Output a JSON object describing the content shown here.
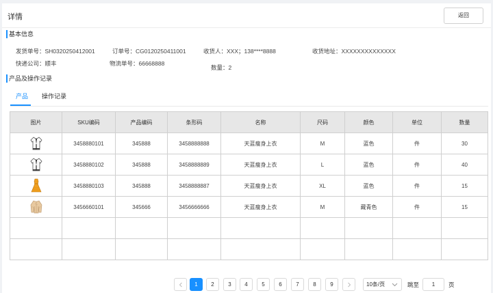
{
  "header": {
    "title": "详情",
    "back_label": "返回"
  },
  "basic": {
    "section_title": "基本信息",
    "ship_no": "发货单号：SH0320250412001",
    "order_no": "订单号：CG0120250411001",
    "receiver": "收货人：XXX；138****8888",
    "address": "收货地址：XXXXXXXXXXXXXX",
    "courier": "快递公司：顺丰",
    "tracking": "物流单号：66668888",
    "qty": "数量：2"
  },
  "products": {
    "section_title": "产品及操作记录",
    "tabs": [
      {
        "label": "产品"
      },
      {
        "label": "操作记录"
      }
    ],
    "columns": [
      "图片",
      "SKU编码",
      "产品编码",
      "条形码",
      "名称",
      "尺码",
      "颜色",
      "单位",
      "数量"
    ],
    "rows": [
      {
        "image": "white-top-thumbnail",
        "sku": "3458880101",
        "code": "345888",
        "barcode": "3458888888",
        "name": "天蓝瘦身上衣",
        "size": "M",
        "color": "蓝色",
        "unit": "件",
        "qty": "30"
      },
      {
        "image": "white-top-thumbnail",
        "sku": "3458880102",
        "code": "345888",
        "barcode": "3458888889",
        "name": "天蓝瘦身上衣",
        "size": "L",
        "color": "蓝色",
        "unit": "件",
        "qty": "40"
      },
      {
        "image": "yellow-dress-thumbnail",
        "sku": "3458880103",
        "code": "345888",
        "barcode": "3458888887",
        "name": "天蓝瘦身上衣",
        "size": "XL",
        "color": "蓝色",
        "unit": "件",
        "qty": "15"
      },
      {
        "image": "beige-jacket-thumbnail",
        "sku": "3456660101",
        "code": "345666",
        "barcode": "3456666666",
        "name": "天蓝瘦身上衣",
        "size": "M",
        "color": "藏青色",
        "unit": "件",
        "qty": "15"
      }
    ]
  },
  "pagination": {
    "prev_icon": "chevron-left-icon",
    "next_icon": "chevron-right-icon",
    "pages": [
      "1",
      "2",
      "3",
      "4",
      "5",
      "6",
      "7",
      "8",
      "9"
    ],
    "current": "1",
    "page_size": "10条/页",
    "jump_label": "跳至",
    "jump_value": "1",
    "page_suffix": "页"
  },
  "colors": {
    "accent": "#1890ff",
    "header_bg": "#e7e7e7"
  }
}
